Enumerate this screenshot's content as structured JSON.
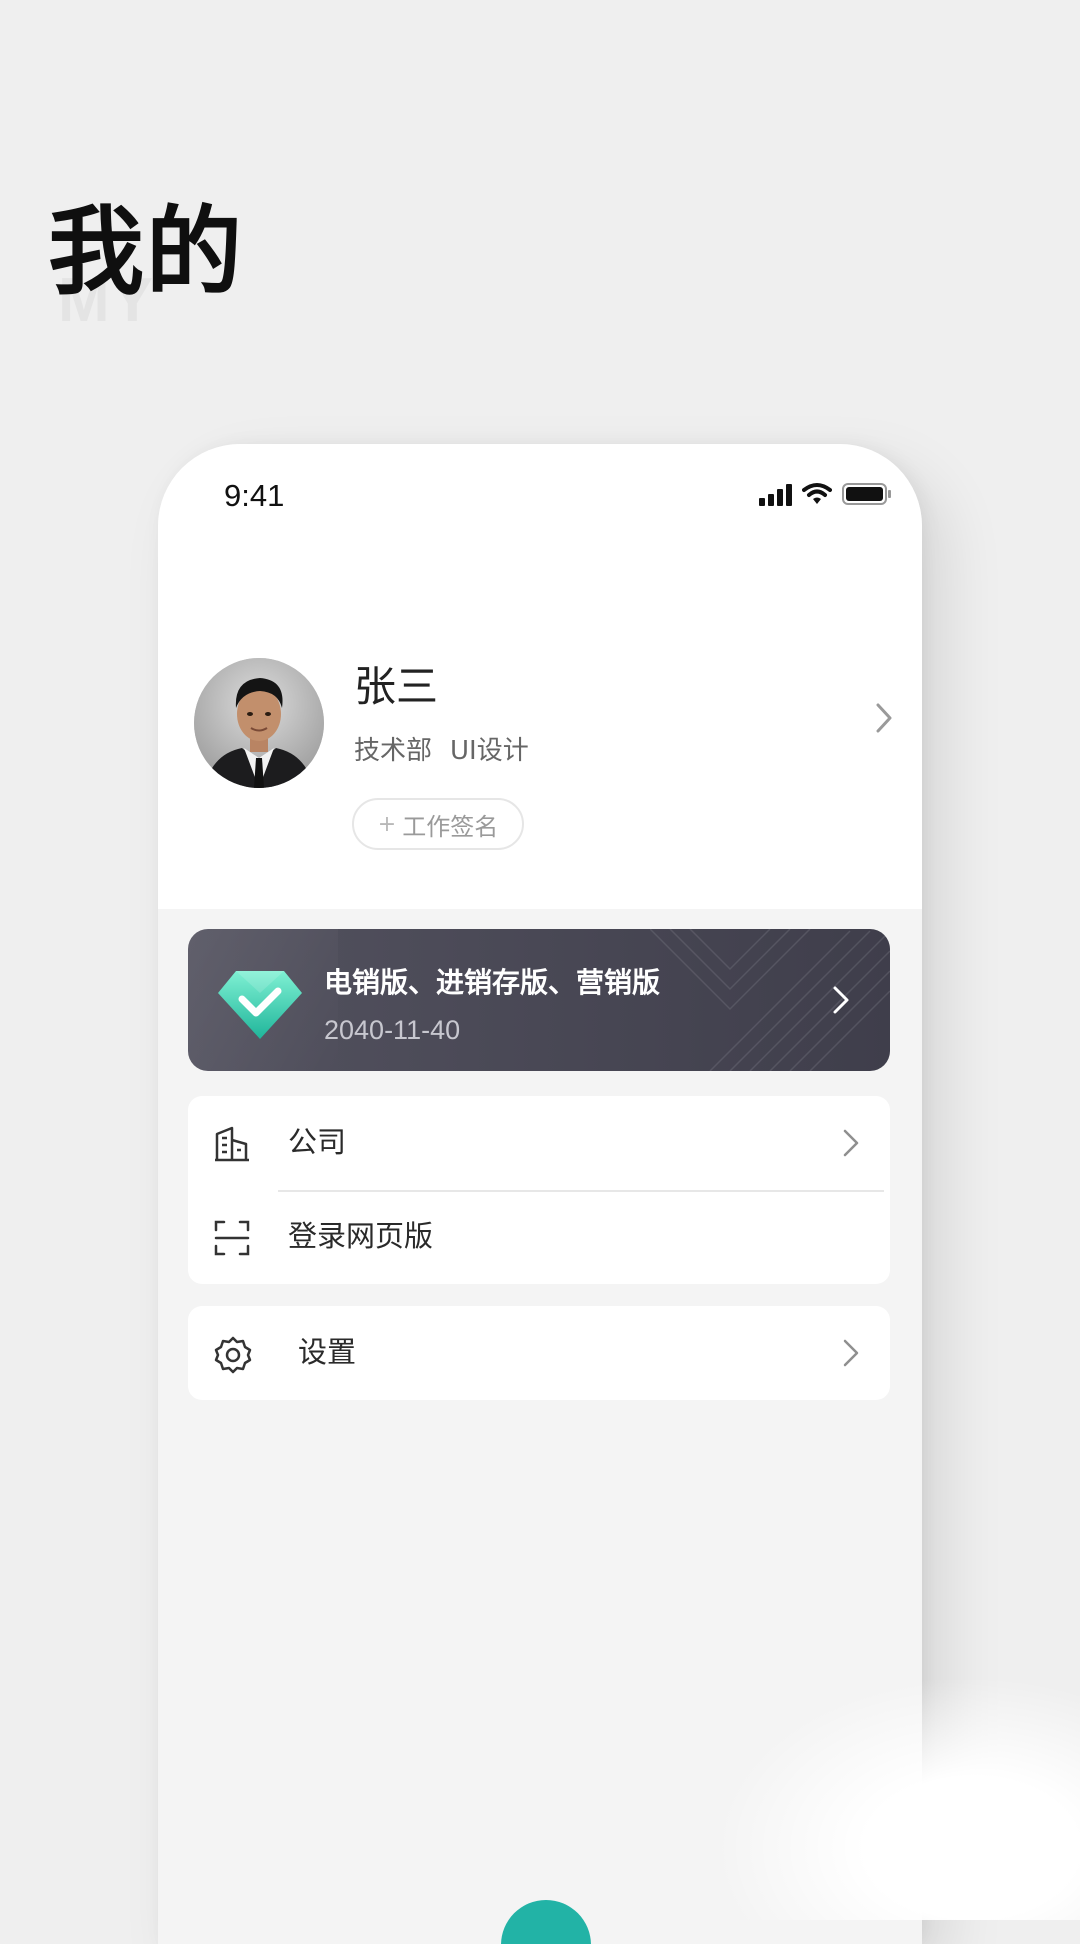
{
  "page": {
    "title": "我的",
    "subtitle": "MY"
  },
  "status_bar": {
    "time": "9:41",
    "icons": [
      "signal-icon",
      "wifi-icon",
      "battery-icon"
    ]
  },
  "profile": {
    "name": "张三",
    "department": "技术部",
    "role": "UI设计",
    "signature_button": {
      "plus": "+",
      "label": "工作签名"
    }
  },
  "plan_card": {
    "title": "电销版、进销存版、营销版",
    "date": "2040-11-40",
    "icon": "diamond-check-icon"
  },
  "menu": {
    "group1": [
      {
        "icon": "building-icon",
        "label": "公司",
        "chevron": true
      },
      {
        "icon": "scan-icon",
        "label": "登录网页版",
        "chevron": false
      }
    ],
    "group2": [
      {
        "icon": "gear-icon",
        "label": "设置",
        "chevron": true
      }
    ]
  },
  "colors": {
    "accent": "#22b3a6",
    "plan_card_bg": "#46454f",
    "page_bg": "#efefef"
  }
}
